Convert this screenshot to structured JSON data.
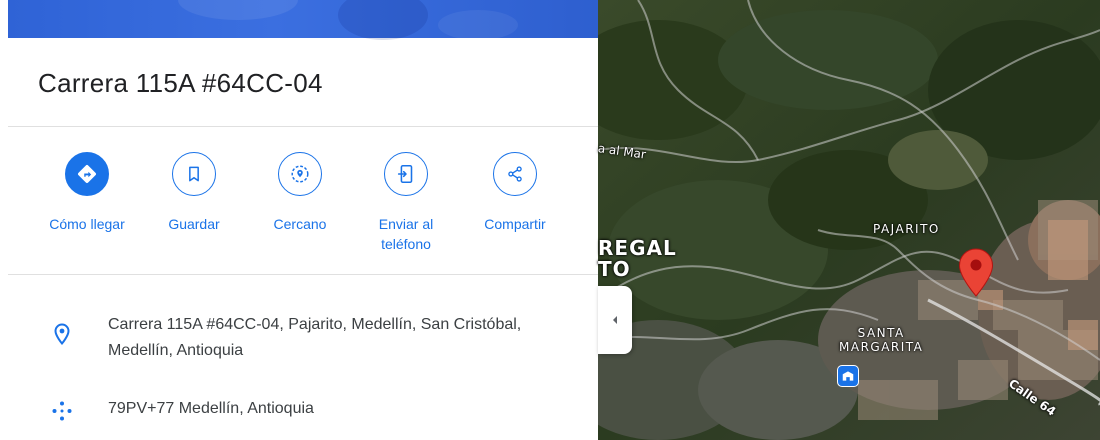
{
  "place": {
    "title": "Carrera 115A #64CC-04"
  },
  "actions": [
    {
      "label": "Cómo llegar",
      "icon": "directions-icon"
    },
    {
      "label": "Guardar",
      "icon": "bookmark-icon"
    },
    {
      "label": "Cercano",
      "icon": "nearby-icon"
    },
    {
      "label": "Enviar al\nteléfono",
      "icon": "send-to-phone-icon"
    },
    {
      "label": "Compartir",
      "icon": "share-icon"
    }
  ],
  "info": {
    "address": "Carrera 115A #64CC-04, Pajarito, Medellín, San Cristóbal, Medellín, Antioquia",
    "plus_code": "79PV+77 Medellín, Antioquia"
  },
  "map": {
    "labels": {
      "regal": "REGAL\nTO",
      "pajarito": "PAJARITO",
      "santa_margarita": "SANTA\nMARGARITA",
      "road_mar": "a al Mar",
      "calle64": "Calle 64"
    }
  },
  "colors": {
    "accent": "#1a73e8",
    "pin": "#ea4335",
    "text_primary": "#202124",
    "text_secondary": "#3c4043"
  }
}
